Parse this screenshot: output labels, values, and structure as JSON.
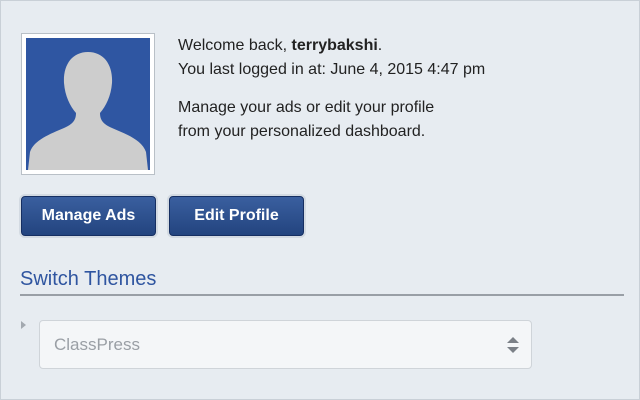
{
  "welcome": {
    "prefix": "Welcome back, ",
    "username": "terrybakshi",
    "suffix": ".",
    "last_login_label": "You last logged in at: ",
    "last_login_time": "June 4, 2015 4:47 pm",
    "description_line1": "Manage your ads or edit your profile",
    "description_line2": "from your personalized dashboard."
  },
  "actions": {
    "manage_ads_label": "Manage Ads",
    "edit_profile_label": "Edit Profile"
  },
  "themes": {
    "section_title": "Switch Themes",
    "selected_theme": "ClassPress"
  },
  "colors": {
    "accent": "#2f55a0",
    "button": "#2b4f8f",
    "avatar_bg": "#2f56a2",
    "panel_bg": "#e7ecf1"
  },
  "icons": {
    "avatar": "default-user-silhouette-icon",
    "select": "up-down-chevron-icon",
    "expander": "caret-right-icon"
  }
}
